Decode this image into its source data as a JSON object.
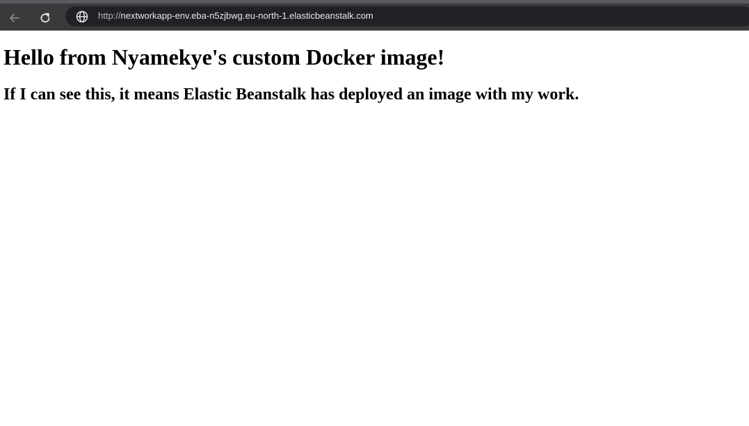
{
  "browser": {
    "url_scheme": "http://",
    "url_host": "nextworkapp-env.eba-n5zjbwg.eu-north-1.elasticbeanstalk.com",
    "icons": {
      "back": "back-arrow-icon",
      "reload": "reload-icon",
      "site_info": "globe-icon"
    }
  },
  "page": {
    "heading": "Hello from Nyamekye's custom Docker image!",
    "subheading": "If I can see this, it means Elastic Beanstalk has deployed an image with my work."
  }
}
